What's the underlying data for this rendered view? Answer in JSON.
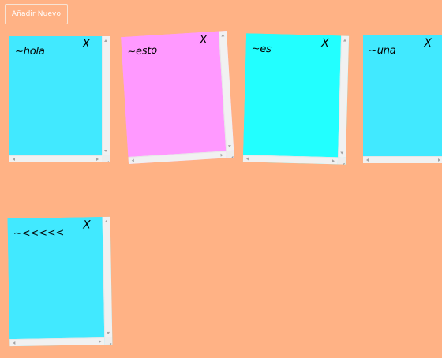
{
  "toolbar": {
    "add_button_label": "Añadir Nuevo"
  },
  "colors": {
    "background": "#FFB285",
    "note_blue": "#41E9FF",
    "note_pink": "#FF99FF",
    "note_cyan": "#22FFFF",
    "scrollbar": "#F1F1F1"
  },
  "notes": [
    {
      "text": "~hola",
      "close_label": "X",
      "color": "#41E9FF"
    },
    {
      "text": "~esto",
      "close_label": "X",
      "color": "#FF99FF"
    },
    {
      "text": "~es",
      "close_label": "X",
      "color": "#22FFFF"
    },
    {
      "text": "~una",
      "close_label": "X",
      "color": "#41E9FF"
    },
    {
      "text": "~<<<<<",
      "close_label": "X",
      "color": "#41E9FF"
    }
  ]
}
